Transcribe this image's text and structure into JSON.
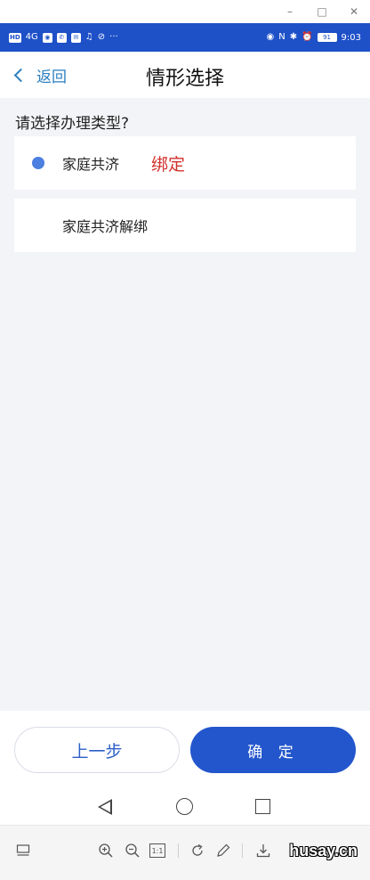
{
  "window": {
    "minimize_glyph": "–",
    "maximize_glyph": "□",
    "close_glyph": "✕"
  },
  "status_bar": {
    "left_chips": [
      "HD",
      "4G",
      "◉",
      "✆",
      "✉",
      "♫",
      "⊘"
    ],
    "more": "···",
    "right_glyphs": [
      "◉",
      "N",
      "✱",
      "⏰"
    ],
    "battery": "91",
    "time": "9:03"
  },
  "header": {
    "back_label": "返回",
    "title": "情形选择"
  },
  "form": {
    "question": "请选择办理类型?",
    "options": [
      {
        "label": "家庭共济",
        "selected": true,
        "annotation": "绑定"
      },
      {
        "label": "家庭共济解绑",
        "selected": false
      }
    ]
  },
  "actions": {
    "prev_label": "上一步",
    "confirm_label": "确 定"
  },
  "colors": {
    "status_bar": "#1e50c8",
    "primary_button": "#2356cc",
    "radio": "#4b7fe0",
    "annotation": "#d2302b",
    "back_link": "#2a7fbf"
  },
  "viewer_toolbar": {
    "icons": [
      "thumbnail-icon",
      "zoom-in-icon",
      "zoom-out-icon",
      "actual-size-icon",
      "rotate-icon",
      "edit-icon",
      "download-icon"
    ],
    "actual_size_label": "1:1",
    "watermark": "husay.cn"
  }
}
